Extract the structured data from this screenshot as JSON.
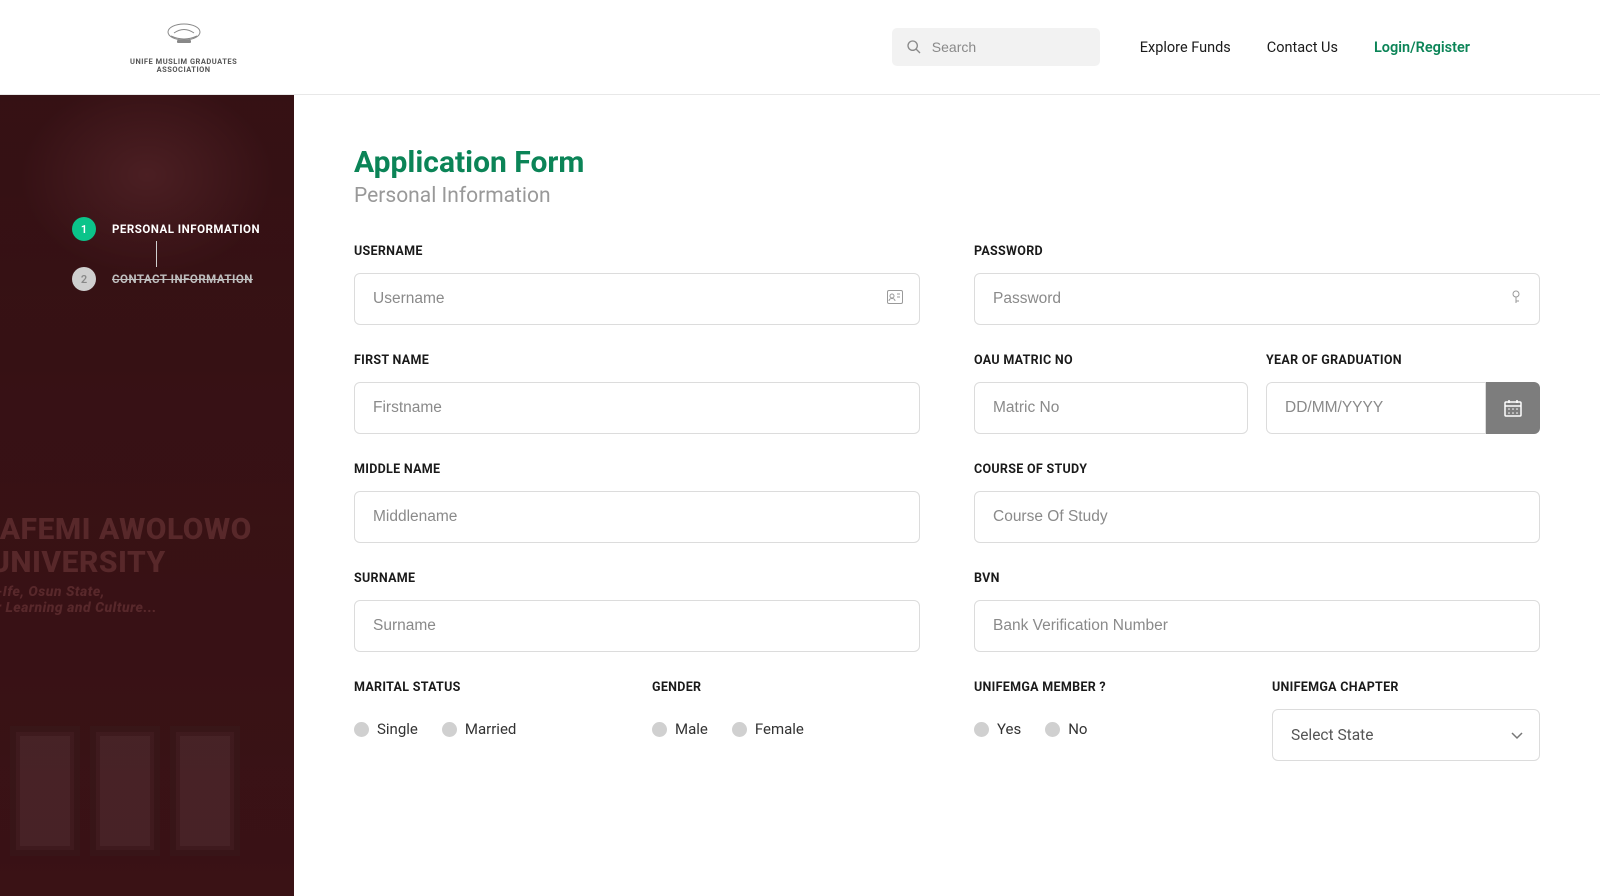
{
  "header": {
    "logo_line1": "UNIFE MUSLIM GRADUATES",
    "logo_line2": "ASSOCIATION",
    "search_placeholder": "Search",
    "nav": {
      "explore": "Explore Funds",
      "contact": "Contact Us",
      "login": "Login/Register"
    }
  },
  "sidebar": {
    "steps": [
      {
        "num": "1",
        "label": "PERSONAL INFORMATION"
      },
      {
        "num": "2",
        "label": "CONTACT INFORMATION"
      }
    ],
    "bg_lines": {
      "l1": "BAFEMI AWOLOWO",
      "l2": "UNIVERSITY",
      "l3": "Ile-Ife, Osun State,",
      "l4": "For Learning and Culture..."
    }
  },
  "page": {
    "title": "Application Form",
    "subtitle": "Personal Information"
  },
  "labels": {
    "username": "USERNAME",
    "password": "PASSWORD",
    "firstname": "FIRST NAME",
    "matric": "OAU MATRIC NO",
    "gradyear": "YEAR OF GRADUATION",
    "middlename": "MIDDLE NAME",
    "course": "COURSE OF STUDY",
    "surname": "SURNAME",
    "bvn": "BVN",
    "marital": "MARITAL STATUS",
    "gender": "GENDER",
    "member": "UNIFEMGA MEMBER ?",
    "chapter": "UNIFEMGA CHAPTER"
  },
  "placeholders": {
    "username": "Username",
    "password": "Password",
    "firstname": "Firstname",
    "matric": "Matric No",
    "gradyear": "DD/MM/YYYY",
    "middlename": "Middlename",
    "course": "Course Of Study",
    "surname": "Surname",
    "bvn": "Bank Verification Number",
    "chapter": "Select State"
  },
  "options": {
    "marital": {
      "a": "Single",
      "b": "Married"
    },
    "gender": {
      "a": "Male",
      "b": "Female"
    },
    "member": {
      "a": "Yes",
      "b": "No"
    }
  }
}
